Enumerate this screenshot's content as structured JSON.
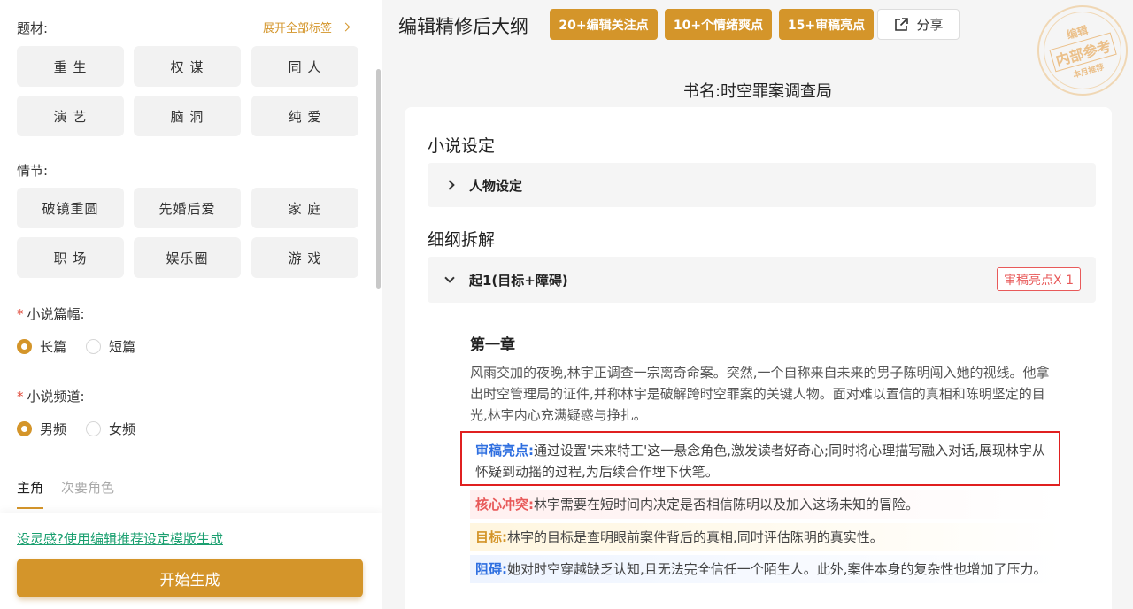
{
  "left": {
    "genre": {
      "label": "题材:",
      "expand_label": "展开全部标签",
      "tags": [
        "重 生",
        "权 谋",
        "同 人",
        "演 艺",
        "脑 洞",
        "纯 爱"
      ]
    },
    "plot": {
      "label": "情节:",
      "tags": [
        "破镜重圆",
        "先婚后爱",
        "家 庭",
        "职 场",
        "娱乐圈",
        "游 戏"
      ]
    },
    "length": {
      "required_mark": "*",
      "label": "小说篇幅:",
      "options": [
        "长篇",
        "短篇"
      ],
      "selected": "长篇"
    },
    "channel": {
      "required_mark": "*",
      "label": "小说频道:",
      "options": [
        "男频",
        "女频"
      ],
      "selected": "男频"
    },
    "tabs": [
      "主角",
      "次要角色"
    ],
    "active_tab": "主角",
    "template_link": "没灵感?使用编辑推荐设定模版生成",
    "start_button": "开始生成"
  },
  "right": {
    "title": "编辑精修后大纲",
    "badges": [
      "20+编辑关注点",
      "10+个情绪爽点",
      "15+审稿亮点"
    ],
    "share_label": "分享",
    "stamp": {
      "top": "编辑",
      "middle": "内部参考",
      "bottom": "本月推荐"
    },
    "book_name": "书名:时空罪案调查局",
    "settings_heading": "小说设定",
    "character_settings": "人物设定",
    "outline_heading": "细纲拆解",
    "section": {
      "label": "起1(目标+障碍)",
      "pill": "审稿亮点X 1"
    },
    "chapter_title": "第一章",
    "chapter_text": "风雨交加的夜晚,林宇正调查一宗离奇命案。突然,一个自称来自未来的男子陈明闯入她的视线。他拿出时空管理局的证件,并称林宇是破解跨时空罪案的关键人物。面对难以置信的真相和陈明坚定的目光,林宇内心充满疑惑与挣扎。",
    "highlight": {
      "key": "审稿亮点:",
      "text": "通过设置'未来特工'这一悬念角色,激发读者好奇心;同时将心理描写融入对话,展现林宇从怀疑到动摇的过程,为后续合作埋下伏笔。"
    },
    "conflict": {
      "key": "核心冲突:",
      "text": "林宇需要在短时间内决定是否相信陈明以及加入这场未知的冒险。"
    },
    "goal": {
      "key": "目标:",
      "text": "林宇的目标是查明眼前案件背后的真相,同时评估陈明的真实性。"
    },
    "obstacle": {
      "key": "阻碍:",
      "text": "她对时空穿越缺乏认知,且无法完全信任一个陌生人。此外,案件本身的复杂性也增加了压力。"
    }
  }
}
